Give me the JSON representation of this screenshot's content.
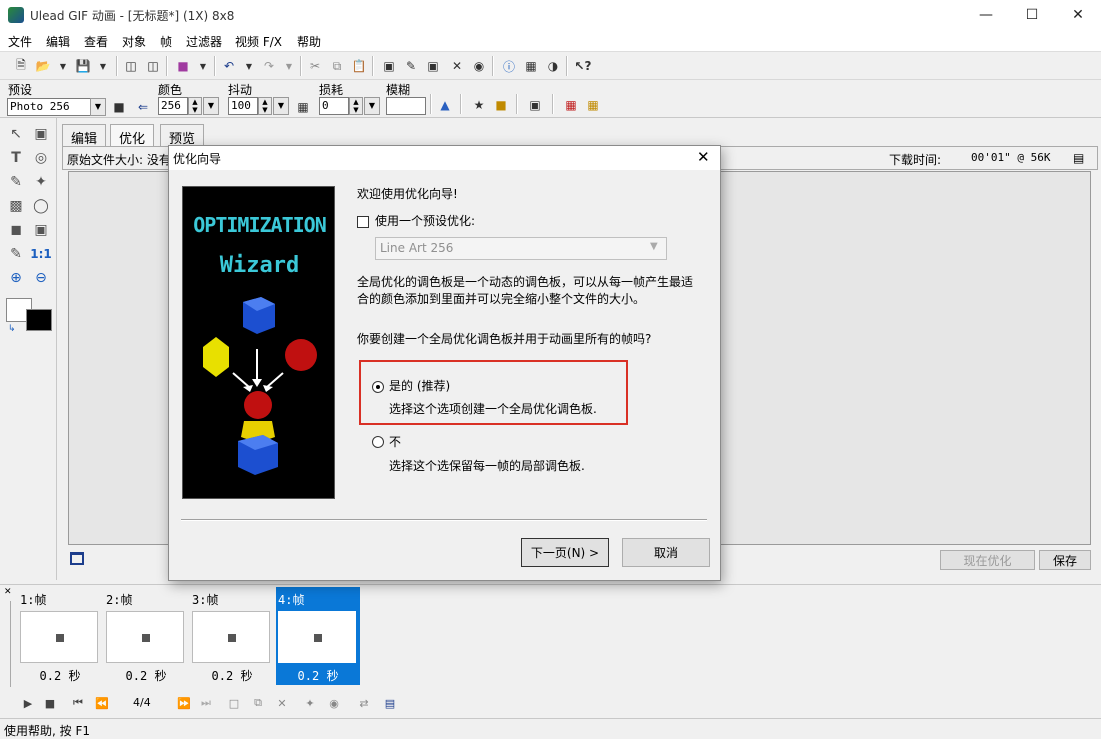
{
  "window": {
    "title": "Ulead GIF 动画 - [无标题*] (1X) 8x8",
    "min_icon": "minimize-icon",
    "max_icon": "maximize-icon",
    "close_icon": "close-icon"
  },
  "menu": [
    "文件",
    "编辑",
    "查看",
    "对象",
    "帧",
    "过滤器",
    "视频 F/X",
    "帮助"
  ],
  "toolbar2": {
    "preset_label": "预设",
    "preset_value": "Photo 256",
    "colors_label": "颜色",
    "colors_value": "256",
    "dither_label": "抖动",
    "dither_value": "100",
    "lossy_label": "损耗",
    "lossy_value": "0",
    "blur_label": "模糊",
    "blur_value": ""
  },
  "tabs": [
    "编辑",
    "优化",
    "预览"
  ],
  "panel": {
    "original_size_label": "原始文件大小: 没有",
    "download_time_label": "下载时间:",
    "download_time_value": "00'01\" @ 56K"
  },
  "bottom_buttons": {
    "optimize_now": "现在优化",
    "save": "保存"
  },
  "frames": [
    {
      "label": "1:帧",
      "time": "0.2 秒"
    },
    {
      "label": "2:帧",
      "time": "0.2 秒"
    },
    {
      "label": "3:帧",
      "time": "0.2 秒"
    },
    {
      "label": "4:帧",
      "time": "0.2 秒"
    }
  ],
  "playbar": {
    "frame_counter": "4/4"
  },
  "status": "使用帮助, 按 F1",
  "dialog": {
    "title": "优化向导",
    "image_title_line1": "OPTIMIZATION",
    "image_title_line2": "Wizard",
    "welcome": "欢迎使用优化向导!",
    "use_preset_label": "使用一个预设优化:",
    "preset_select_value": "Line Art 256",
    "description": "全局优化的调色板是一个动态的调色板，可以从每一帧产生最适合的颜色添加到里面并可以完全缩小整个文件的大小。",
    "question": "你要创建一个全局优化调色板并用于动画里所有的帧吗?",
    "option_yes_label": "是的 (推荐)",
    "option_yes_desc": "选择这个选项创建一个全局优化调色板.",
    "option_no_label": "不",
    "option_no_desc": "选择这个选保留每一帧的局部调色板.",
    "next_button": "下一页(N) >",
    "cancel_button": "取消"
  }
}
